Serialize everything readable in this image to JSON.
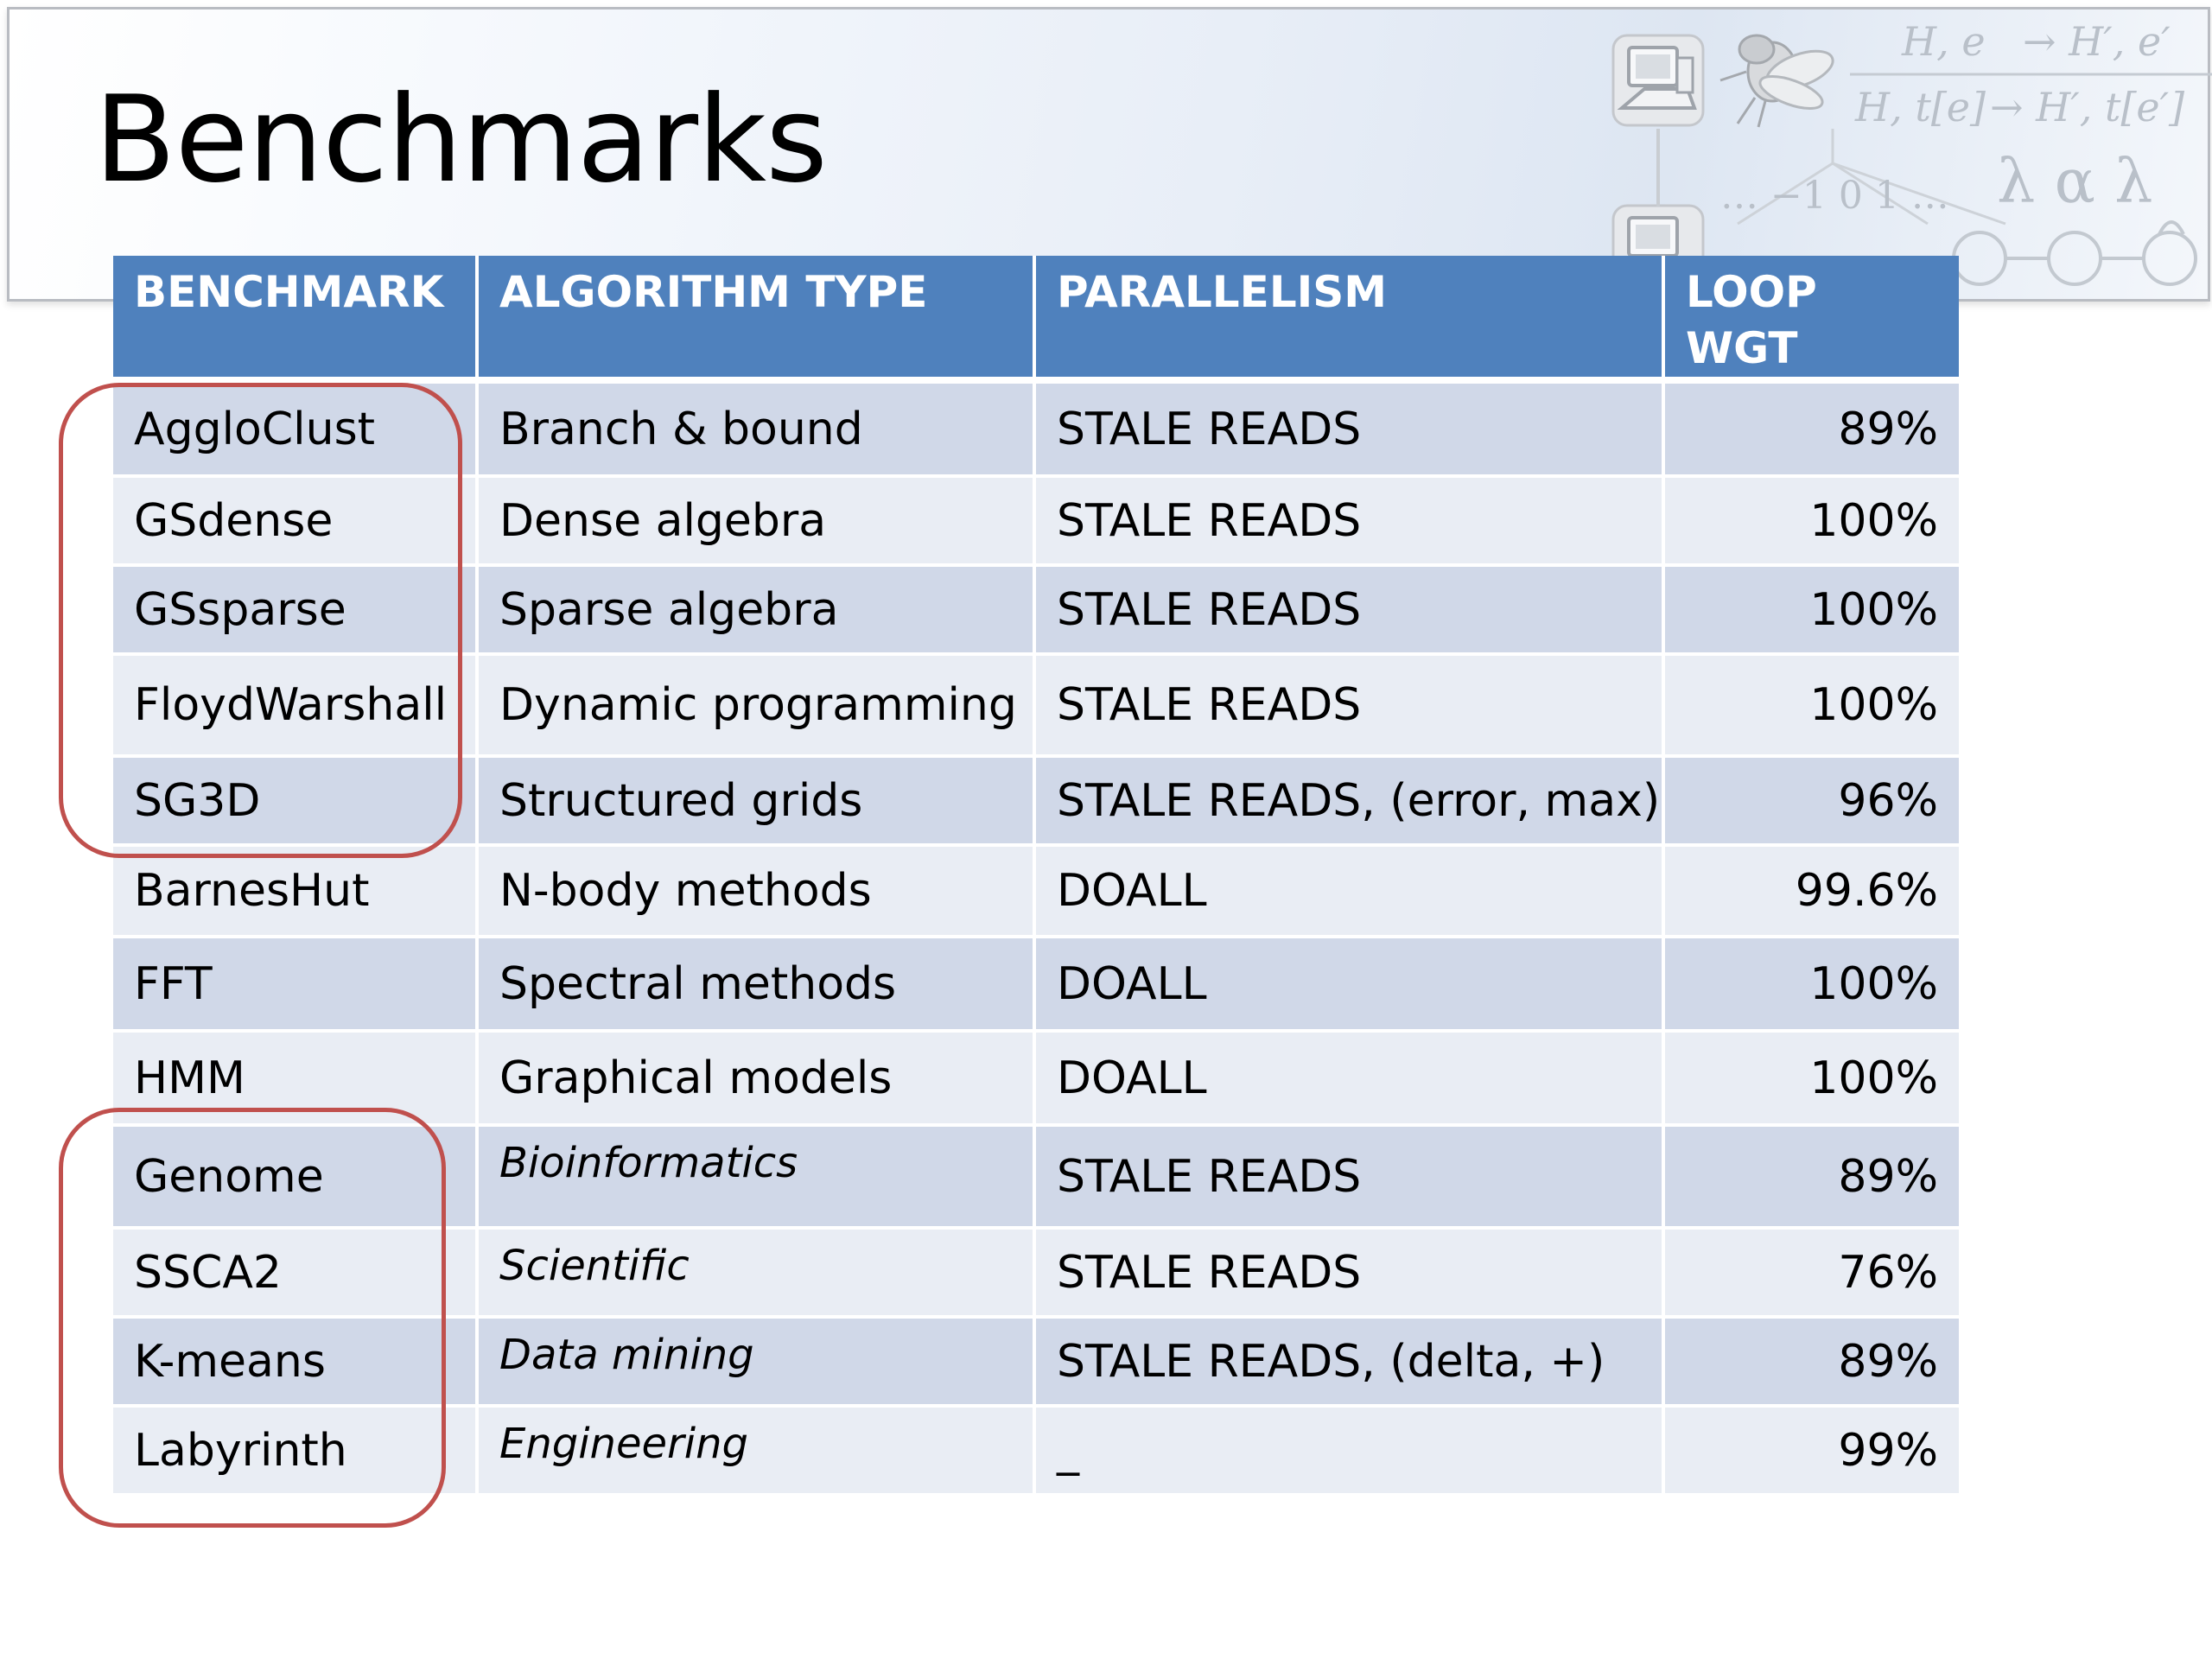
{
  "slide": {
    "title": "Benchmarks"
  },
  "decor": {
    "formula_top_left": "H, e",
    "formula_top_right": "→ H′, e′",
    "formula_bottom_left": "H, t[e]",
    "formula_bottom_right": "→ H′, t[e′]",
    "number_line": "… −1  0  1 …",
    "greek": "λ α λ",
    "icons": [
      "computer-icon",
      "computer-icon",
      "fly-icon",
      "state-machine-icon"
    ]
  },
  "table": {
    "headers": [
      "BENCHMARK",
      "ALGORITHM TYPE",
      "PARALLELISM",
      "LOOP WGT"
    ],
    "rows": [
      {
        "benchmark": "AggloClust",
        "algorithm": "Branch & bound",
        "parallelism": "STALE READS",
        "loop_wgt": "89%"
      },
      {
        "benchmark": "GSdense",
        "algorithm": "Dense algebra",
        "parallelism": "STALE READS",
        "loop_wgt": "100%"
      },
      {
        "benchmark": "GSsparse",
        "algorithm": "Sparse algebra",
        "parallelism": "STALE READS",
        "loop_wgt": "100%"
      },
      {
        "benchmark": "FloydWarshall",
        "algorithm": "Dynamic programming",
        "parallelism": "STALE READS",
        "loop_wgt": "100%"
      },
      {
        "benchmark": "SG3D",
        "algorithm": "Structured grids",
        "parallelism": "STALE READS, (error, max)",
        "loop_wgt": "96%"
      },
      {
        "benchmark": "BarnesHut",
        "algorithm": "N-body methods",
        "parallelism": "DOALL",
        "loop_wgt": "99.6%"
      },
      {
        "benchmark": "FFT",
        "algorithm": "Spectral methods",
        "parallelism": "DOALL",
        "loop_wgt": "100%"
      },
      {
        "benchmark": "HMM",
        "algorithm": "Graphical models",
        "parallelism": "DOALL",
        "loop_wgt": "100%"
      },
      {
        "benchmark": "Genome",
        "algorithm": "Bioinformatics",
        "parallelism": "STALE READS",
        "loop_wgt": "89%"
      },
      {
        "benchmark": "SSCA2",
        "algorithm": "Scientific",
        "parallelism": "STALE READS",
        "loop_wgt": "76%"
      },
      {
        "benchmark": "K-means",
        "algorithm": "Data mining",
        "parallelism": "STALE READS, (delta, +)",
        "loop_wgt": "89%"
      },
      {
        "benchmark": "Labyrinth",
        "algorithm": "Engineering",
        "parallelism": "_",
        "loop_wgt": "99%"
      }
    ]
  },
  "colors": {
    "header_bg": "#4f81bd",
    "row_dark": "#d0d8e8",
    "row_light": "#e9edf4",
    "highlight_outline": "#c0504d"
  }
}
